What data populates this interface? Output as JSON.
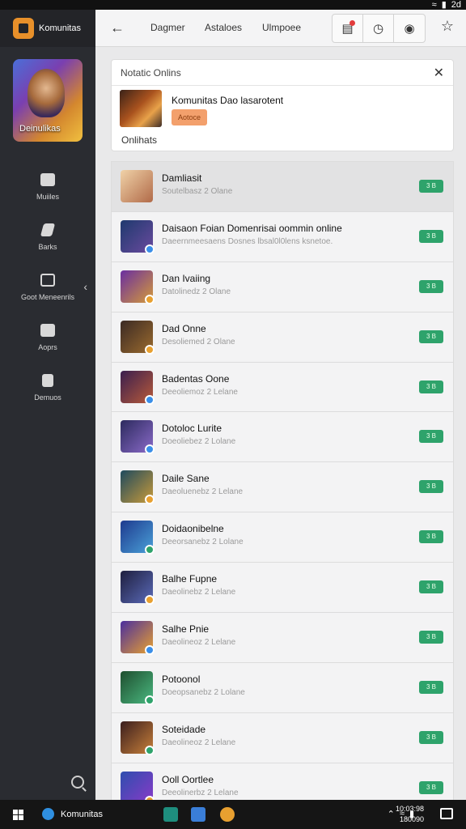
{
  "status_bar": {
    "time": "2d",
    "icons": [
      "wifi-icon",
      "battery-icon"
    ]
  },
  "sidebar": {
    "brand": "Komunitas",
    "hero_label": "Deinulikas",
    "items": [
      {
        "label": "Muiiles",
        "icon": "home-icon"
      },
      {
        "label": "Barks",
        "icon": "edit-icon"
      },
      {
        "label": "Goot Meneenrils",
        "icon": "monitor-icon"
      },
      {
        "label": "Aoprs",
        "icon": "mail-icon"
      },
      {
        "label": "Demuos",
        "icon": "document-icon"
      }
    ]
  },
  "topbar": {
    "tabs": [
      "Dagmer",
      "Astaloes",
      "Ulmpoee"
    ],
    "icons": [
      "notification-icon",
      "clock-icon",
      "settings-icon",
      "star-icon"
    ]
  },
  "notice": {
    "header": "Notatic Onlins",
    "title": "Komunitas Dao lasarotent",
    "tag": "Aotoce",
    "footer": "Onlihats"
  },
  "list": [
    {
      "title": "Damliasit",
      "subtitle": "Soutelbasz 2 Olane",
      "status": "3 B"
    },
    {
      "title": "Daisaon Foian Domenrisai oommin online",
      "subtitle": "Daeernmeesaens Dosnes lbsal0l0lens ksnetoe.",
      "status": "3 B"
    },
    {
      "title": "Dan Ivaiing",
      "subtitle": "Datolinedz 2 Olane",
      "status": "3 B"
    },
    {
      "title": "Dad Onne",
      "subtitle": "Desoliemed 2 Olane",
      "status": "3 B"
    },
    {
      "title": "Badentas Oone",
      "subtitle": "Deeoliemoz 2 Lelane",
      "status": "3 B"
    },
    {
      "title": "Dotoloc Lurite",
      "subtitle": "Doeoliebez 2 Lolane",
      "status": "3 B"
    },
    {
      "title": "Daile Sane",
      "subtitle": "Daeoluenebz 2 Lelane",
      "status": "3 B"
    },
    {
      "title": "Doidaonibelne",
      "subtitle": "Deeorsanebz 2 Lolane",
      "status": "3 B"
    },
    {
      "title": "Balhe Fupne",
      "subtitle": "Daeolinebz 2 Lelane",
      "status": "3 B"
    },
    {
      "title": "Salhe Pnie",
      "subtitle": "Daeolineoz 2 Lelane",
      "status": "3 B"
    },
    {
      "title": "Potoonol",
      "subtitle": "Doeopsanebz 2 Lolane",
      "status": "3 B"
    },
    {
      "title": "Soteidade",
      "subtitle": "Daeolineoz 2 Lelane",
      "status": "3 B"
    },
    {
      "title": "Ooll Oortlee",
      "subtitle": "Deeolinerbz 2 Lelane",
      "status": "3 B"
    }
  ],
  "avatar_colors": [
    [
      "#f0d2a8",
      "#b16a48"
    ],
    [
      "#1e3a6e",
      "#6a4a9e"
    ],
    [
      "#6a2ea0",
      "#d49a3a"
    ],
    [
      "#3b2a24",
      "#9a6a2e"
    ],
    [
      "#3a1e4e",
      "#b85a3a"
    ],
    [
      "#2c2a5e",
      "#8a6ac8"
    ],
    [
      "#1e4a5e",
      "#c89a3a"
    ],
    [
      "#1e3a8e",
      "#4aa0d8"
    ],
    [
      "#1e1e3e",
      "#5a6ab8"
    ],
    [
      "#4a2e9e",
      "#e8a030"
    ],
    [
      "#1e4e2e",
      "#4ab880"
    ],
    [
      "#3a1e1e",
      "#c8803a"
    ],
    [
      "#2e4eae",
      "#8a3ac8"
    ]
  ],
  "badge_colors": [
    "#3a8ee8",
    "#3a8ee8",
    "#e8a030",
    "#e8a030",
    "#3a8ee8",
    "#3a8ee8",
    "#e8a030",
    "#2ea36b",
    "#e8a030",
    "#3a8ee8",
    "#2ea36b",
    "#2ea36b",
    "#e8a030"
  ],
  "taskbar": {
    "app_label": "Komunitas",
    "clock_time": "10:03:98",
    "clock_date": "180090"
  }
}
